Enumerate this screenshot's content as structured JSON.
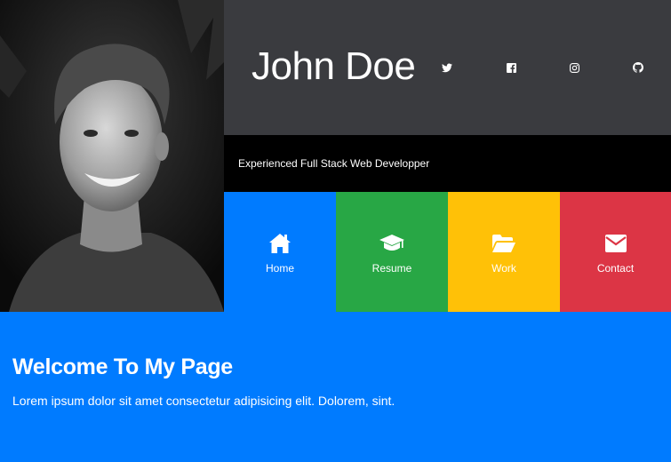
{
  "profile": {
    "name": "John Doe",
    "tagline": "Experienced Full Stack Web Developper",
    "photo": "portrait-photo-grayscale"
  },
  "social": [
    {
      "icon": "twitter-icon"
    },
    {
      "icon": "facebook-icon"
    },
    {
      "icon": "instagram-icon"
    },
    {
      "icon": "github-icon"
    }
  ],
  "nav": [
    {
      "label": "Home",
      "icon": "home-icon",
      "color": "#007bff"
    },
    {
      "label": "Resume",
      "icon": "graduation-cap-icon",
      "color": "#28a745"
    },
    {
      "label": "Work",
      "icon": "folder-open-icon",
      "color": "#ffc107"
    },
    {
      "label": "Contact",
      "icon": "envelope-icon",
      "color": "#dc3545"
    }
  ],
  "welcome": {
    "title": "Welcome To My Page",
    "body": "Lorem ipsum dolor sit amet consectetur adipisicing elit. Dolorem, sint."
  },
  "colors": {
    "header_bg": "#3a3b3f",
    "tagline_bg": "#000000",
    "welcome_bg": "#007bff"
  }
}
